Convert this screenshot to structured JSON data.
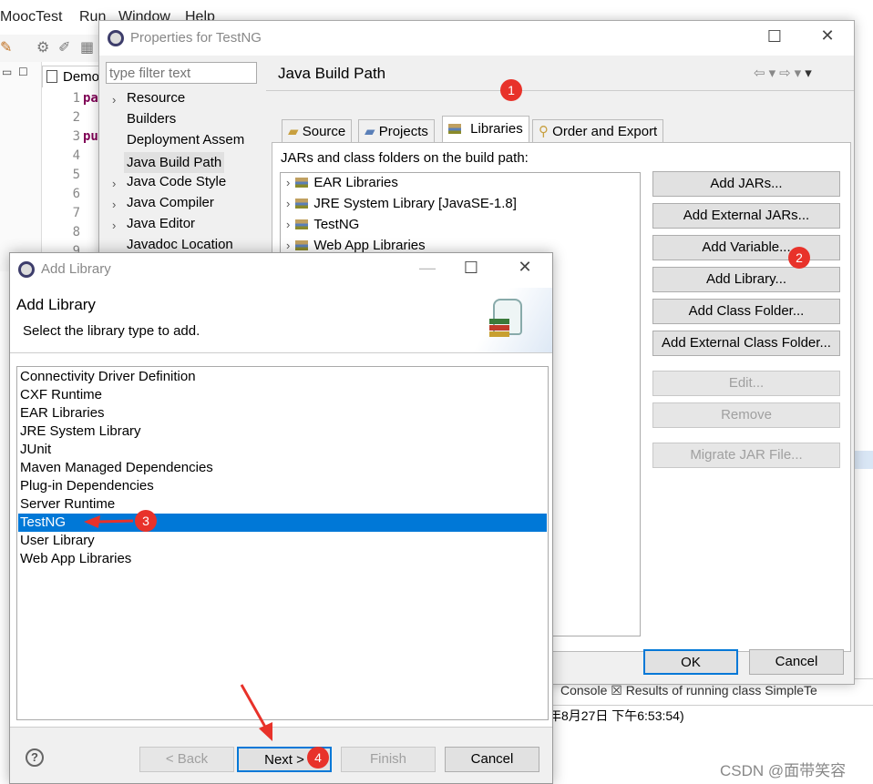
{
  "ide": {
    "menu": [
      "MoocTest",
      "Run",
      "Window",
      "Help"
    ],
    "editor_tab": "Demo",
    "line_numbers": [
      "1",
      "2",
      "3",
      "4",
      "5",
      "6",
      "7",
      "8",
      "9"
    ],
    "code_snippets": [
      "pa",
      "pu"
    ],
    "console_tabs": "Console ☒ Results of running class SimpleTe",
    "console_text": "年8月27日 下午6:53:54)"
  },
  "properties_dialog": {
    "title": "Properties for TestNG",
    "filter_placeholder": "type filter text",
    "tree": [
      {
        "label": "Resource",
        "has_arrow": true
      },
      {
        "label": "Builders",
        "has_arrow": false
      },
      {
        "label": "Deployment Assem",
        "has_arrow": false
      },
      {
        "label": "Java Build Path",
        "has_arrow": false,
        "selected": true
      },
      {
        "label": "Java Code Style",
        "has_arrow": true
      },
      {
        "label": "Java Compiler",
        "has_arrow": true
      },
      {
        "label": "Java Editor",
        "has_arrow": true
      },
      {
        "label": "Javadoc Location",
        "has_arrow": false
      }
    ],
    "page_title": "Java Build Path",
    "tabs": [
      {
        "label": "Source",
        "icon": "source-folder-icon"
      },
      {
        "label": "Projects",
        "icon": "projects-icon"
      },
      {
        "label": "Libraries",
        "icon": "libraries-icon",
        "active": true
      },
      {
        "label": "Order and Export",
        "icon": "order-export-icon"
      }
    ],
    "build_path_label": "JARs and class folders on the build path:",
    "libraries": [
      "EAR Libraries",
      "JRE System Library [JavaSE-1.8]",
      "TestNG",
      "Web App Libraries"
    ],
    "buttons": {
      "add_jars": "Add JARs...",
      "add_external_jars": "Add External JARs...",
      "add_variable": "Add Variable...",
      "add_library": "Add Library...",
      "add_class_folder": "Add Class Folder...",
      "add_external_class_folder": "Add External Class Folder...",
      "edit": "Edit...",
      "remove": "Remove",
      "migrate_jar": "Migrate JAR File...",
      "ok": "OK",
      "cancel": "Cancel"
    }
  },
  "add_library_dialog": {
    "title": "Add Library",
    "header_title": "Add Library",
    "header_subtitle": "Select the library type to add.",
    "items": [
      "Connectivity Driver Definition",
      "CXF Runtime",
      "EAR Libraries",
      "JRE System Library",
      "JUnit",
      "Maven Managed Dependencies",
      "Plug-in Dependencies",
      "Server Runtime",
      "TestNG",
      "User Library",
      "Web App Libraries"
    ],
    "selected_index": 8,
    "buttons": {
      "help": "?",
      "back": "< Back",
      "next": "Next >",
      "finish": "Finish",
      "cancel": "Cancel"
    }
  },
  "annotations": [
    "1",
    "2",
    "3",
    "4"
  ],
  "watermark": "CSDN @面带笑容",
  "colors": {
    "selection": "#0078d7",
    "badge": "#e8322a",
    "arrow": "#e8322a"
  }
}
